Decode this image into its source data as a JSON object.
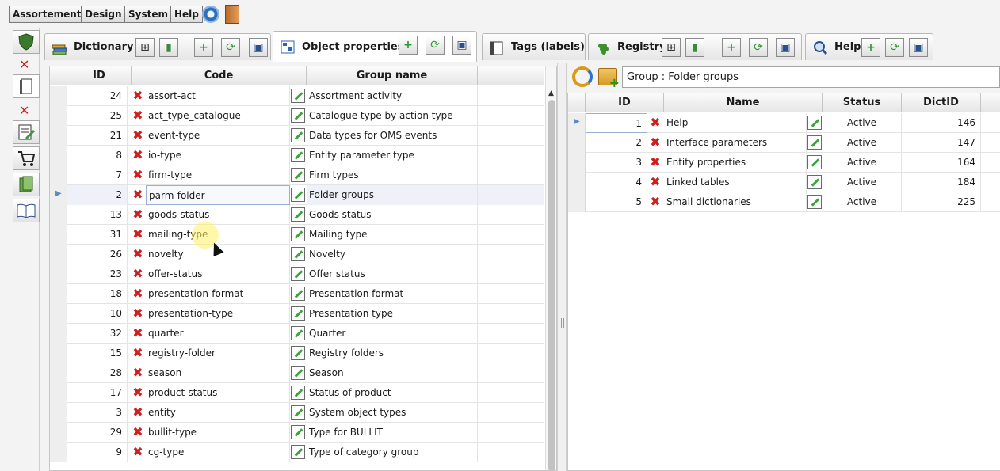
{
  "menu": [
    "Assortement",
    "Design",
    "System",
    "Help"
  ],
  "tabs": [
    {
      "label": "Dictionary",
      "icon": "books-icon"
    },
    {
      "label": "Object properties",
      "icon": "properties-icon"
    },
    {
      "label": "Tags (labels)",
      "icon": "tag-icon"
    },
    {
      "label": "Registry",
      "icon": "grapes-icon"
    },
    {
      "label": "Help",
      "icon": "help-magnifier-icon"
    }
  ],
  "left_grid": {
    "headers": [
      "ID",
      "Code",
      "Group name"
    ],
    "rows": [
      {
        "id": "24",
        "code": "assort-act",
        "name": "Assortment activity"
      },
      {
        "id": "25",
        "code": "act_type_catalogue",
        "name": "Catalogue type by action type"
      },
      {
        "id": "21",
        "code": "event-type",
        "name": "Data types for OMS events"
      },
      {
        "id": "8",
        "code": "io-type",
        "name": "Entity parameter type"
      },
      {
        "id": "7",
        "code": "firm-type",
        "name": "Firm types"
      },
      {
        "id": "2",
        "code": "parm-folder",
        "name": "Folder groups"
      },
      {
        "id": "13",
        "code": "goods-status",
        "name": "Goods status"
      },
      {
        "id": "31",
        "code": "mailing-type",
        "name": "Mailing type"
      },
      {
        "id": "26",
        "code": "novelty",
        "name": "Novelty"
      },
      {
        "id": "23",
        "code": "offer-status",
        "name": "Offer status"
      },
      {
        "id": "18",
        "code": "presentation-format",
        "name": "Presentation format"
      },
      {
        "id": "10",
        "code": "presentation-type",
        "name": "Presentation type"
      },
      {
        "id": "32",
        "code": "quarter",
        "name": "Quarter"
      },
      {
        "id": "15",
        "code": "registry-folder",
        "name": "Registry folders"
      },
      {
        "id": "28",
        "code": "season",
        "name": "Season"
      },
      {
        "id": "17",
        "code": "product-status",
        "name": "Status of product"
      },
      {
        "id": "3",
        "code": "entity",
        "name": "System object types"
      },
      {
        "id": "29",
        "code": "bullit-type",
        "name": "Type for BULLIT"
      },
      {
        "id": "9",
        "code": "cg-type",
        "name": "Type of category group"
      }
    ]
  },
  "right_panel": {
    "group_label": "Group : Folder groups",
    "headers": [
      "ID",
      "Name",
      "Status",
      "DictID"
    ],
    "rows": [
      {
        "id": "1",
        "name": "Help",
        "status": "Active",
        "dictid": "146"
      },
      {
        "id": "2",
        "name": "Interface parameters",
        "status": "Active",
        "dictid": "147"
      },
      {
        "id": "3",
        "name": "Entity properties",
        "status": "Active",
        "dictid": "164"
      },
      {
        "id": "4",
        "name": "Linked tables",
        "status": "Active",
        "dictid": "184"
      },
      {
        "id": "5",
        "name": "Small dictionaries",
        "status": "Active",
        "dictid": "225"
      }
    ]
  }
}
